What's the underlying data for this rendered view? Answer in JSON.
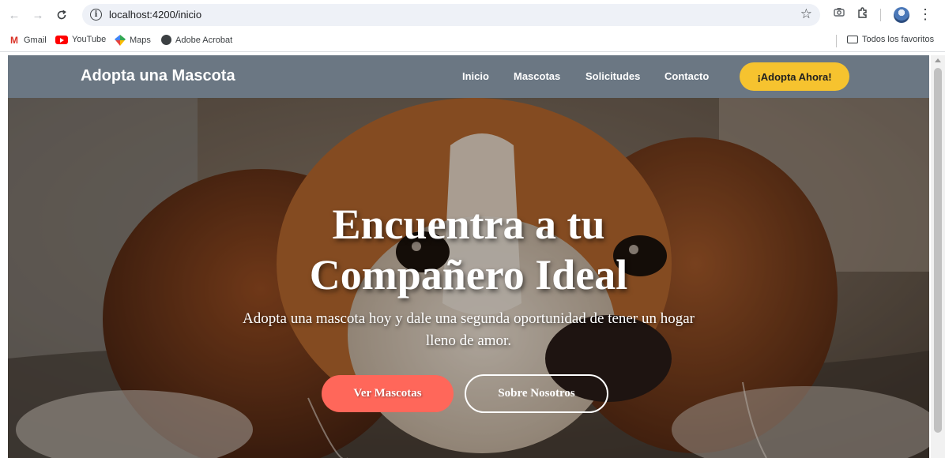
{
  "browser": {
    "url": "localhost:4200/inicio",
    "bookmarks": [
      {
        "label": "Gmail",
        "icon": "gmail-icon"
      },
      {
        "label": "YouTube",
        "icon": "youtube-icon"
      },
      {
        "label": "Maps",
        "icon": "maps-icon"
      },
      {
        "label": "Adobe Acrobat",
        "icon": "acrobat-icon"
      }
    ],
    "all_bookmarks_label": "Todos los favoritos"
  },
  "site": {
    "brand": "Adopta una Mascota",
    "nav": [
      "Inicio",
      "Mascotas",
      "Solicitudes",
      "Contacto"
    ],
    "cta": "¡Adopta Ahora!"
  },
  "hero": {
    "title_line1": "Encuentra a tu",
    "title_line2": "Compañero Ideal",
    "subtitle_line1": "Adopta una mascota hoy y dale una segunda oportunidad de tener un hogar",
    "subtitle_line2": "lleno de amor.",
    "primary_button": "Ver Mascotas",
    "secondary_button": "Sobre Nosotros"
  },
  "colors": {
    "navbar": "#6b7783",
    "cta_nav": "#f6c32f",
    "primary_button": "#ff675a",
    "omnibox": "#eef1f7"
  }
}
